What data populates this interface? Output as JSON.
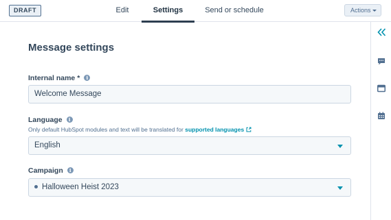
{
  "header": {
    "badge": "DRAFT",
    "tabs": {
      "edit": "Edit",
      "settings": "Settings",
      "send": "Send or schedule"
    },
    "actions_label": "Actions"
  },
  "main": {
    "title": "Message settings",
    "internal_name": {
      "label": "Internal name *",
      "value": "Welcome Message"
    },
    "language": {
      "label": "Language",
      "help_text": "Only default HubSpot modules and text will be translated for ",
      "help_link": "supported languages",
      "value": "English"
    },
    "campaign": {
      "label": "Campaign",
      "value": "Halloween Heist 2023"
    }
  },
  "info_icon_glyph": "i",
  "icons": [
    "chevron-double-left-icon",
    "comments-icon",
    "preview-icon",
    "calendar-icon"
  ],
  "colors": {
    "accent": "#0091ae",
    "text": "#33475b",
    "input_bg": "#f5f8fa",
    "border": "#cbd6e2"
  }
}
